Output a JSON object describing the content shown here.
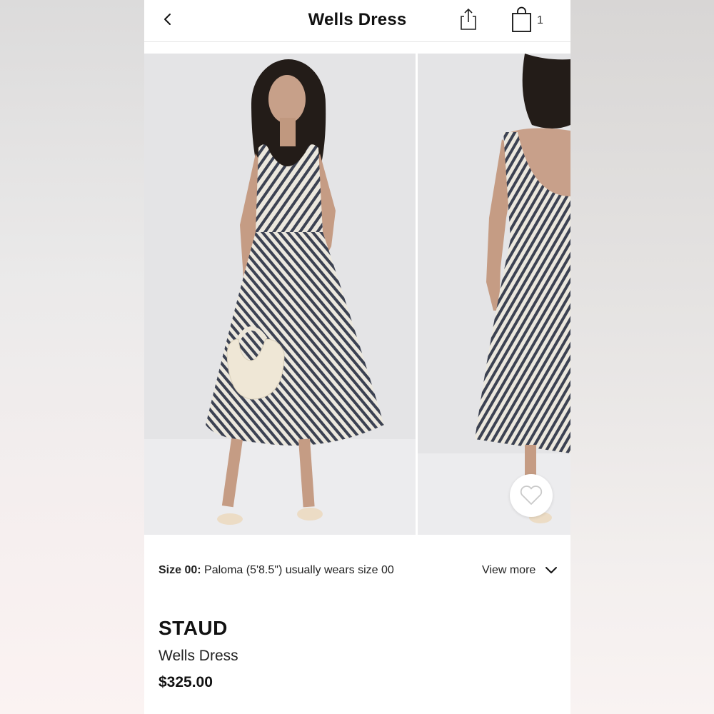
{
  "header": {
    "title": "Wells Dress",
    "bag_count": "1",
    "icons": {
      "back": "chevron-left-icon",
      "share": "share-icon",
      "bag": "shopping-bag-icon"
    }
  },
  "gallery": {
    "images": [
      "front view photo",
      "back view photo"
    ],
    "wishlist_icon": "heart-icon"
  },
  "size_info": {
    "label": "Size 00:",
    "text": "Paloma (5'8.5\") usually wears size 00",
    "view_more": "View more"
  },
  "product": {
    "brand": "STAUD",
    "name": "Wells Dress",
    "price": "$325.00"
  },
  "colors": {
    "text": "#111111",
    "divider": "#e6e6e6",
    "photo_bg": "#e6e6e8"
  }
}
